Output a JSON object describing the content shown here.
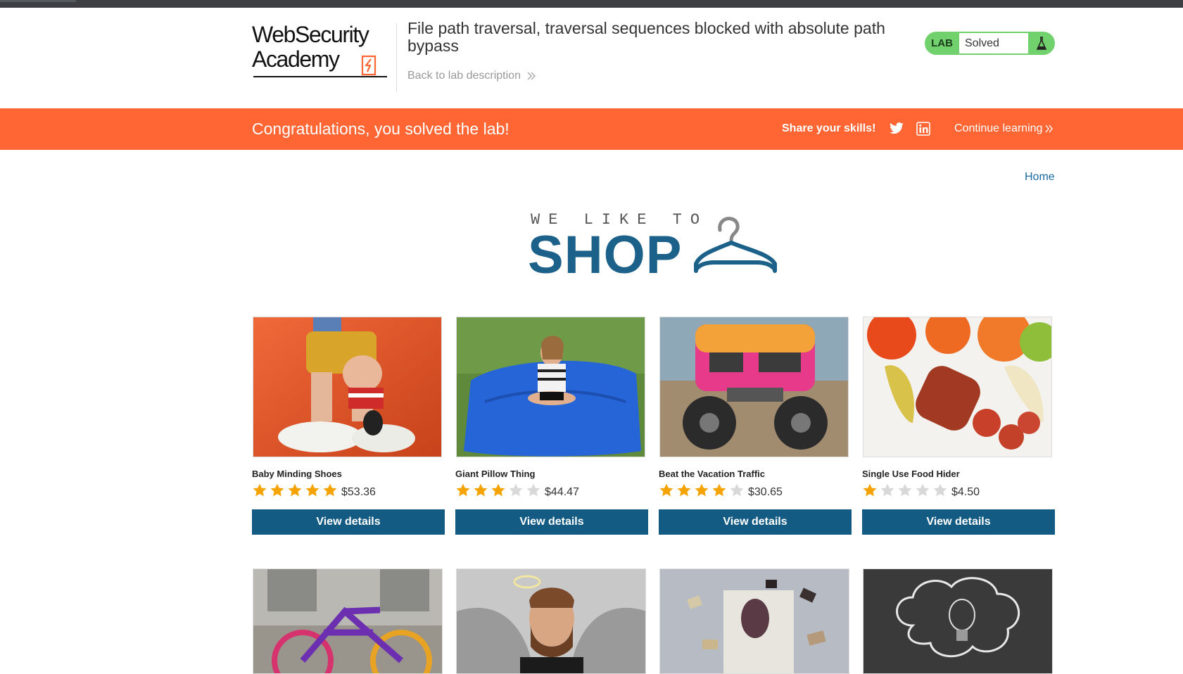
{
  "header": {
    "logo_line1": "WebSecurity",
    "logo_line2": "Academy",
    "lab_title": "File path traversal, traversal sequences blocked with absolute path bypass",
    "back_link": "Back to lab description",
    "status_label": "LAB",
    "status_value": "Solved"
  },
  "banner": {
    "message": "Congratulations, you solved the lab!",
    "share": "Share your skills!",
    "continue": "Continue learning",
    "twitter_icon": "twitter-icon",
    "linkedin_icon": "linkedin-icon"
  },
  "nav": {
    "home": "Home"
  },
  "shop": {
    "tagline": "WE LIKE TO",
    "title": "SHOP"
  },
  "products": [
    {
      "name": "Baby Minding Shoes",
      "price": "$53.36",
      "rating": 5,
      "button": "View details",
      "image": "baby-minding-shoes-image"
    },
    {
      "name": "Giant Pillow Thing",
      "price": "$44.47",
      "rating": 3,
      "button": "View details",
      "image": "giant-pillow-image"
    },
    {
      "name": "Beat the Vacation Traffic",
      "price": "$30.65",
      "rating": 4,
      "button": "View details",
      "image": "monster-van-image"
    },
    {
      "name": "Single Use Food Hider",
      "price": "$4.50",
      "rating": 1,
      "button": "View details",
      "image": "food-hider-image"
    }
  ],
  "products_row2": [
    {
      "image": "knitted-bicycle-image"
    },
    {
      "image": "angel-man-image"
    },
    {
      "image": "floating-books-image"
    },
    {
      "image": "lightbulb-cloud-image"
    }
  ],
  "colors": {
    "accent": "#ff6633",
    "button": "#145b84",
    "status": "#70d16d",
    "link": "#1a6aa3",
    "star_on": "#f5a300",
    "star_off": "#d8d8d8"
  }
}
